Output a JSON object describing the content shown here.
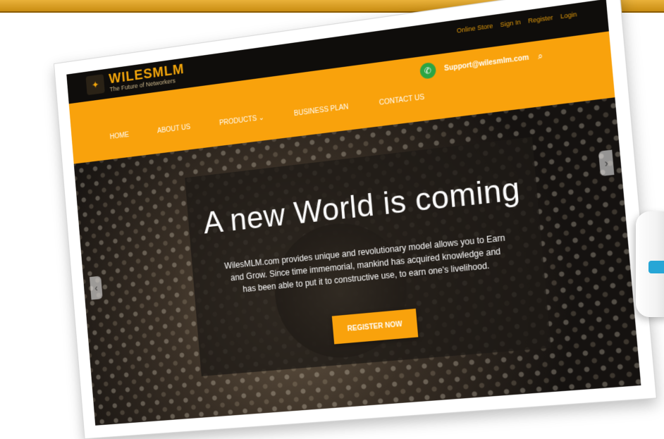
{
  "site": {
    "brand": "WILESMLM",
    "tagline": "The Future of Networkers",
    "top_links": [
      "Online Store",
      "Sign In",
      "Register",
      "Login"
    ],
    "contact_email": "Support@wilesmlm.com",
    "nav": [
      "HOME",
      "ABOUT US",
      "PRODUCTS",
      "BUSINESS PLAN",
      "CONTACT US"
    ]
  },
  "hero": {
    "headline": "A new World is coming",
    "description": "WilesMLM.com provides unique and revolutionary model allows you to Earn and Grow. Since time immemorial, mankind has acquired knowledge and has been able to put it to constructive use, to earn one's livelihood.",
    "cta_label": "REGISTER NOW"
  },
  "colors": {
    "primary": "#f9a20c",
    "dark": "#0f0d0b",
    "accent_green": "#2ca544",
    "accent_blue": "#27a6d6"
  },
  "icons": {
    "logo": "logo-mark-icon",
    "whatsapp": "whatsapp-icon",
    "search": "search-icon",
    "left_arrow": "chevron-left-icon",
    "right_arrow": "chevron-right-icon",
    "dropdown": "chevron-down-icon"
  }
}
